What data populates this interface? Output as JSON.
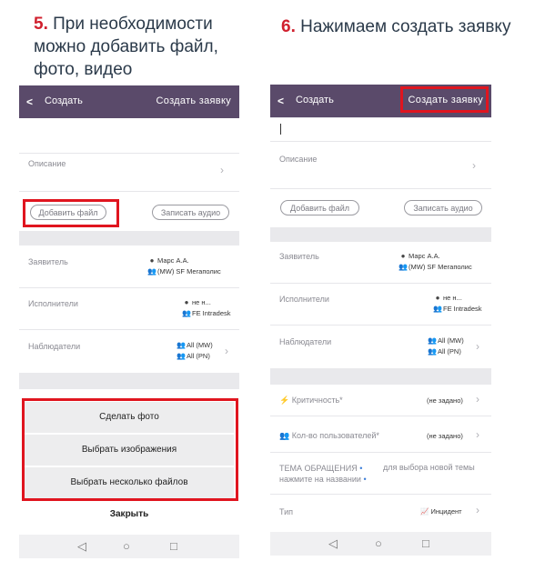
{
  "captions": {
    "left": {
      "num": "5.",
      "text": "При необходимости можно добавить файл, фото, видео"
    },
    "right": {
      "num": "6.",
      "text": "Нажимаем создать заявку"
    }
  },
  "header": {
    "back": "<",
    "create": "Создать",
    "submit": "Создать заявку"
  },
  "form": {
    "description": "Описание",
    "add_file": "Добавить файл",
    "record_audio": "Записать аудио",
    "applicant": {
      "label": "Заявитель",
      "name": "Марс А.А.",
      "group": "(MW) SF Мегаполис"
    },
    "executors": {
      "label": "Исполнители",
      "name": "не н...",
      "group": "FE Intradesk"
    },
    "observers": {
      "label": "Наблюдатели",
      "group1": "All (MW)",
      "group2": "All (PN)"
    },
    "criticality": {
      "label": "Критичность*",
      "value": "(не задано)"
    },
    "users_count": {
      "label": "Кол-во пользователей*",
      "value": "(не задано)"
    },
    "topic": {
      "line1": "ТЕМА ОБРАЩЕНИЯ",
      "line2": "нажмите на названии",
      "hint": "для выбора новой темы"
    },
    "type": {
      "label": "Тип",
      "value": "Инцидент"
    }
  },
  "sheet": {
    "take_photo": "Сделать фото",
    "choose_images": "Выбрать изображения",
    "choose_files": "Выбрать несколько файлов",
    "close": "Закрыть"
  },
  "nav": {
    "back": "◁",
    "home": "○",
    "recent": "□"
  },
  "colors": {
    "header": "#5a4a6a",
    "highlight": "#e0151f",
    "step_number": "#d0202e"
  }
}
